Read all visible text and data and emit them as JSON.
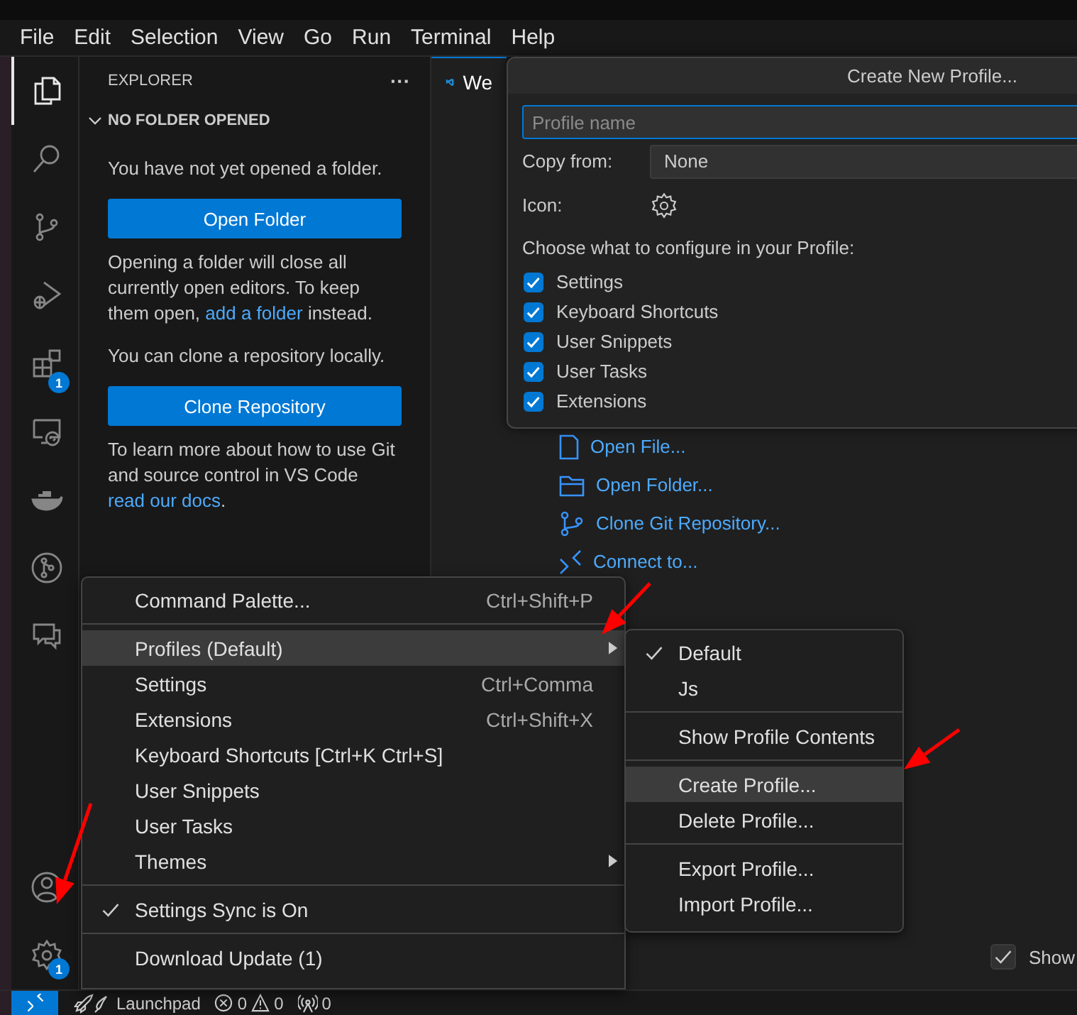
{
  "menu_bar": [
    "File",
    "Edit",
    "Selection",
    "View",
    "Go",
    "Run",
    "Terminal",
    "Help"
  ],
  "activity_bar": {
    "items": [
      {
        "kind": "explorer",
        "selected": true
      },
      {
        "kind": "search",
        "selected": false
      },
      {
        "kind": "source-control",
        "selected": false
      },
      {
        "kind": "run-debug",
        "selected": false
      },
      {
        "kind": "extensions",
        "selected": false,
        "badge": "1"
      },
      {
        "kind": "remote",
        "selected": false
      },
      {
        "kind": "docker",
        "selected": false
      },
      {
        "kind": "git-graph",
        "selected": false
      },
      {
        "kind": "chat",
        "selected": false
      }
    ],
    "bottom": [
      {
        "kind": "accounts"
      },
      {
        "kind": "manage",
        "badge": "1"
      }
    ]
  },
  "sidebar": {
    "title": "EXPLORER",
    "more": "···",
    "section": {
      "title": "NO FOLDER OPENED",
      "expanded": true
    },
    "content": [
      {
        "kind": "text",
        "parts": [
          {
            "text": "You have not yet opened a folder.",
            "link": false
          }
        ]
      },
      {
        "kind": "button",
        "label": "Open Folder"
      },
      {
        "kind": "text",
        "parts": [
          {
            "text": "Opening a folder will close all currently open editors. To keep them open, ",
            "link": false
          },
          {
            "text": "add a folder",
            "link": true
          },
          {
            "text": " instead.",
            "link": false
          }
        ]
      },
      {
        "kind": "text",
        "parts": [
          {
            "text": "You can clone a repository locally.",
            "link": false
          }
        ]
      },
      {
        "kind": "button",
        "label": "Clone Repository"
      },
      {
        "kind": "text",
        "parts": [
          {
            "text": "To learn more about how to use Git and source control in VS Code ",
            "link": false
          },
          {
            "text": "read our docs",
            "link": true
          },
          {
            "text": ".",
            "link": false
          }
        ]
      }
    ]
  },
  "editor": {
    "tab": {
      "label": "We",
      "selected": true
    },
    "start_links": [
      {
        "kind": "file",
        "label": "Open File..."
      },
      {
        "kind": "folder",
        "label": "Open Folder..."
      },
      {
        "kind": "git",
        "label": "Clone Git Repository..."
      },
      {
        "kind": "remote",
        "label": "Connect to..."
      }
    ],
    "show_on_startup": {
      "label": "Show",
      "checked": true
    }
  },
  "profile_dialog": {
    "title": "Create New Profile...",
    "name_field": {
      "placeholder": "Profile name"
    },
    "copy_from": {
      "label": "Copy from:",
      "value": "None"
    },
    "icon": {
      "label": "Icon:"
    },
    "configure_heading": "Choose what to configure in your Profile:",
    "options": [
      {
        "label": "Settings",
        "checked": true
      },
      {
        "label": "Keyboard Shortcuts",
        "checked": true
      },
      {
        "label": "User Snippets",
        "checked": true
      },
      {
        "label": "User Tasks",
        "checked": true
      },
      {
        "label": "Extensions",
        "checked": true
      }
    ]
  },
  "context_menu": {
    "items": [
      {
        "kind": "item",
        "label": "Command Palette...",
        "shortcut": "Ctrl+Shift+P",
        "selected": false,
        "checked": false,
        "has_submenu": false
      },
      {
        "kind": "separator"
      },
      {
        "kind": "item",
        "label": "Profiles (Default)",
        "selected": true,
        "checked": false,
        "has_submenu": true
      },
      {
        "kind": "item",
        "label": "Settings",
        "shortcut": "Ctrl+Comma",
        "selected": false,
        "checked": false,
        "has_submenu": false
      },
      {
        "kind": "item",
        "label": "Extensions",
        "shortcut": "Ctrl+Shift+X",
        "selected": false,
        "checked": false,
        "has_submenu": false
      },
      {
        "kind": "item",
        "label": "Keyboard Shortcuts [Ctrl+K Ctrl+S]",
        "selected": false,
        "checked": false,
        "has_submenu": false
      },
      {
        "kind": "item",
        "label": "User Snippets",
        "selected": false,
        "checked": false,
        "has_submenu": false
      },
      {
        "kind": "item",
        "label": "User Tasks",
        "selected": false,
        "checked": false,
        "has_submenu": false
      },
      {
        "kind": "item",
        "label": "Themes",
        "selected": false,
        "checked": false,
        "has_submenu": true
      },
      {
        "kind": "separator"
      },
      {
        "kind": "item",
        "label": "Settings Sync is On",
        "selected": false,
        "checked": true,
        "has_submenu": false
      },
      {
        "kind": "separator"
      },
      {
        "kind": "item",
        "label": "Download Update (1)",
        "selected": false,
        "checked": false,
        "has_submenu": false
      }
    ]
  },
  "profiles_submenu": {
    "items": [
      {
        "kind": "item",
        "label": "Default",
        "selected": false,
        "checked": true,
        "has_submenu": false
      },
      {
        "kind": "item",
        "label": "Js",
        "selected": false,
        "checked": false,
        "has_submenu": false
      },
      {
        "kind": "separator"
      },
      {
        "kind": "item",
        "label": "Show Profile Contents",
        "selected": false,
        "checked": false,
        "has_submenu": false
      },
      {
        "kind": "separator"
      },
      {
        "kind": "item",
        "label": "Create Profile...",
        "selected": true,
        "checked": false,
        "has_submenu": false
      },
      {
        "kind": "item",
        "label": "Delete Profile...",
        "selected": false,
        "checked": false,
        "has_submenu": false
      },
      {
        "kind": "separator"
      },
      {
        "kind": "item",
        "label": "Export Profile...",
        "selected": false,
        "checked": false,
        "has_submenu": false
      },
      {
        "kind": "item",
        "label": "Import Profile...",
        "selected": false,
        "checked": false,
        "has_submenu": false
      }
    ]
  },
  "status_bar": {
    "launchpad": "Launchpad",
    "errors": "0",
    "warnings": "0",
    "ports": "0"
  }
}
